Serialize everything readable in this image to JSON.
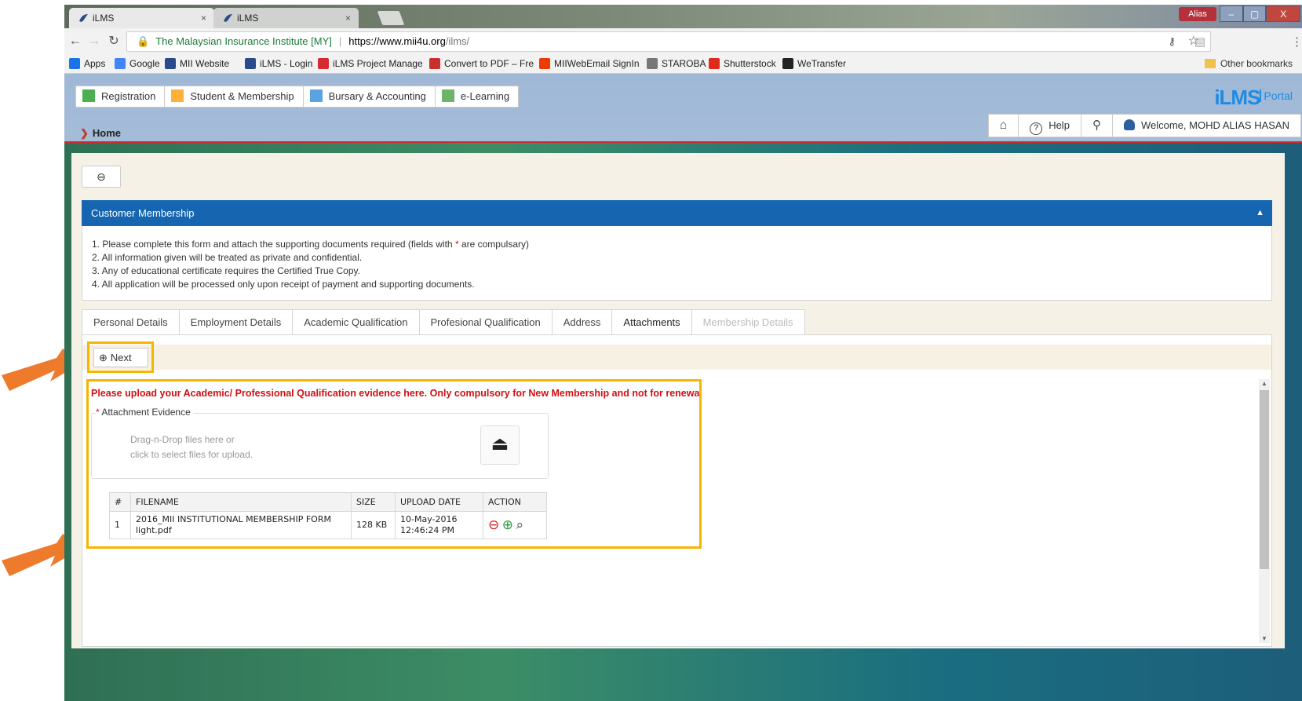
{
  "browser": {
    "tabs": [
      {
        "title": "iLMS",
        "close": "×"
      },
      {
        "title": "iLMS",
        "close": "×"
      }
    ],
    "profile": "Alias",
    "window_controls": {
      "minimize": "‒",
      "maximize": "▢",
      "close": "X"
    },
    "address": {
      "site_name": "The Malaysian Insurance Institute [MY]",
      "url_host": "https://www.mii4u.org",
      "url_path": "/ilms/"
    },
    "bookmarks": [
      {
        "label": "Apps",
        "icon": "apps-grid-icon",
        "color": "#1a73e8"
      },
      {
        "label": "Google",
        "icon": "google-icon",
        "color": "#4285f4"
      },
      {
        "label": "MII Website",
        "icon": "mii-bird-icon",
        "color": "#2a4a8a"
      },
      {
        "label": "iLMS - Login",
        "icon": "mii-bird-icon",
        "color": "#2a4a8a"
      },
      {
        "label": "iLMS Project Manage",
        "icon": "people-icon",
        "color": "#d8292f"
      },
      {
        "label": "Convert to PDF – Fre",
        "icon": "pdf-icon",
        "color": "#c9302c"
      },
      {
        "label": "MIIWebEmail SignIn",
        "icon": "office-icon",
        "color": "#eb3c00"
      },
      {
        "label": "STAROBA",
        "icon": "page-icon",
        "color": "#777777"
      },
      {
        "label": "Shutterstock",
        "icon": "shutterstock-icon",
        "color": "#e02a20"
      },
      {
        "label": "WeTransfer",
        "icon": "wetransfer-icon",
        "color": "#222222"
      }
    ],
    "other_bookmarks": "Other bookmarks"
  },
  "app": {
    "modules": [
      {
        "label": "Registration",
        "color": "#4caf50"
      },
      {
        "label": "Student & Membership",
        "color": "#ffb03b"
      },
      {
        "label": "Bursary & Accounting",
        "color": "#5aa2e0"
      },
      {
        "label": "e-Learning",
        "color": "#6bb56b"
      }
    ],
    "logo": {
      "main": "iLMS",
      "sub": "Portal"
    },
    "breadcrumb": "Home",
    "userbar": {
      "help": "Help",
      "welcome_prefix": "Welcome,",
      "username": "MOHD ALIAS HASAN"
    }
  },
  "form": {
    "panel_title": "Customer Membership",
    "instructions": {
      "line1_pre": "1. Please complete this form and attach the supporting documents required (fields with",
      "line1_star": "*",
      "line1_post": "are compulsary)",
      "line2": "2. All information given will be treated as private and confidential.",
      "line3": "3. Any of educational certificate requires the Certified True Copy.",
      "line4": "4. All application will be processed only upon receipt of payment and supporting documents."
    },
    "tabs": [
      {
        "label": "Personal Details",
        "state": "normal"
      },
      {
        "label": "Employment Details",
        "state": "normal"
      },
      {
        "label": "Academic Qualification",
        "state": "normal"
      },
      {
        "label": "Profesional Qualification",
        "state": "normal"
      },
      {
        "label": "Address",
        "state": "normal"
      },
      {
        "label": "Attachments",
        "state": "active"
      },
      {
        "label": "Membership Details",
        "state": "disabled"
      }
    ],
    "next_label": "Next",
    "notice": "Please upload your Academic/ Professional Qualification evidence here. Only compulsory for New Membership and not for renewal",
    "attachment": {
      "star": "*",
      "legend": "Attachment Evidence",
      "drop_line1": "Drag-n-Drop files here or",
      "drop_line2": "click to select files for upload."
    },
    "files_table": {
      "headers": [
        "#",
        "FILENAME",
        "SIZE",
        "UPLOAD DATE",
        "ACTION"
      ],
      "rows": [
        {
          "num": "1",
          "filename_line1": "2016_MII INSTITUTIONAL MEMBERSHIP FORM",
          "filename_line2": "light.pdf",
          "size": "128 KB",
          "date_line1": "10-May-2016",
          "date_line2": "12:46:24 PM"
        }
      ]
    }
  },
  "annotation_color": "#f7b500",
  "arrow_color": "#ee7a2c"
}
